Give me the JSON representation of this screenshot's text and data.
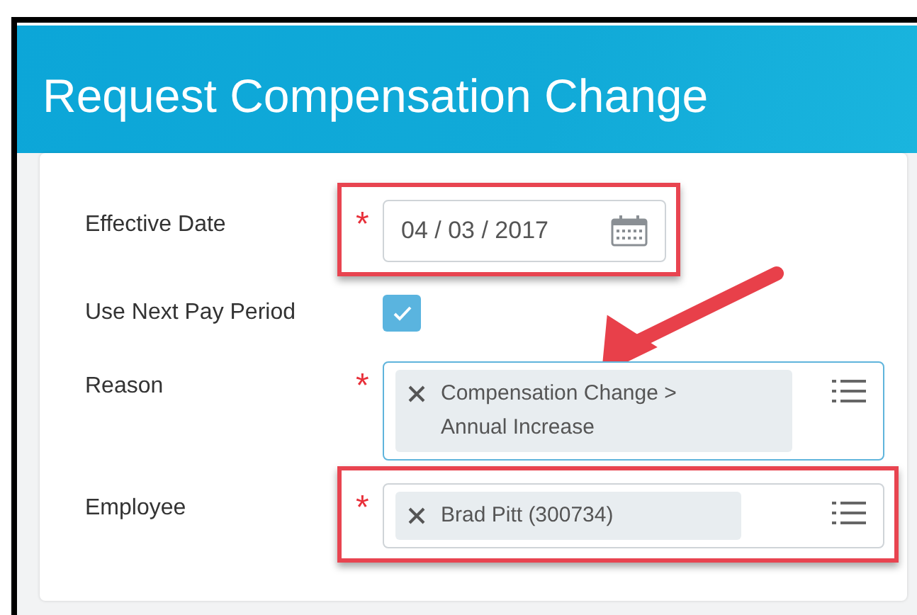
{
  "title": "Request Compensation Change",
  "arrow_annotation": true,
  "fields": [
    {
      "kind": "date",
      "label": "Effective Date",
      "required_mark": "*",
      "value": "04 / 03 / 2017",
      "highlighted": true
    },
    {
      "kind": "checkbox",
      "label": "Use Next Pay Period",
      "checked": true
    },
    {
      "kind": "select",
      "label": "Reason",
      "required_mark": "*",
      "value": "Compensation Change > Annual Increase",
      "focused": true
    },
    {
      "kind": "select",
      "label": "Employee",
      "required_mark": "*",
      "value": "Brad Pitt (300734)",
      "highlighted": true
    }
  ]
}
